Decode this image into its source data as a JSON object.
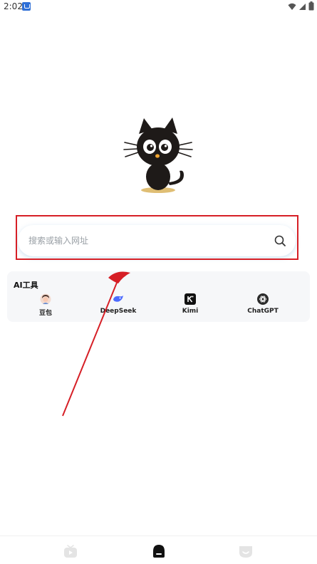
{
  "status_bar": {
    "time": "2:02",
    "icons": [
      "notification-app-icon",
      "wifi-icon",
      "signal-icon",
      "battery-icon"
    ]
  },
  "mascot": {
    "icon": "black-cat-mascot"
  },
  "search": {
    "placeholder": "搜索或输入网址",
    "value": "",
    "icon": "search-icon",
    "highlight_color": "#d61f26"
  },
  "ai_tools": {
    "title": "AI工具",
    "items": [
      {
        "label": "豆包",
        "icon": "doubao-icon"
      },
      {
        "label": "DeepSeek",
        "icon": "deepseek-icon"
      },
      {
        "label": "Kimi",
        "icon": "kimi-icon"
      },
      {
        "label": "ChatGPT",
        "icon": "chatgpt-icon"
      }
    ]
  },
  "annotation": {
    "color": "#d61f26",
    "icon": "red-arrow-annotation"
  },
  "bottom_nav": {
    "items": [
      {
        "name": "tv",
        "icon": "tv-icon",
        "active": false
      },
      {
        "name": "home",
        "icon": "home-icon",
        "active": true
      },
      {
        "name": "profile",
        "icon": "face-icon",
        "active": false
      }
    ]
  }
}
